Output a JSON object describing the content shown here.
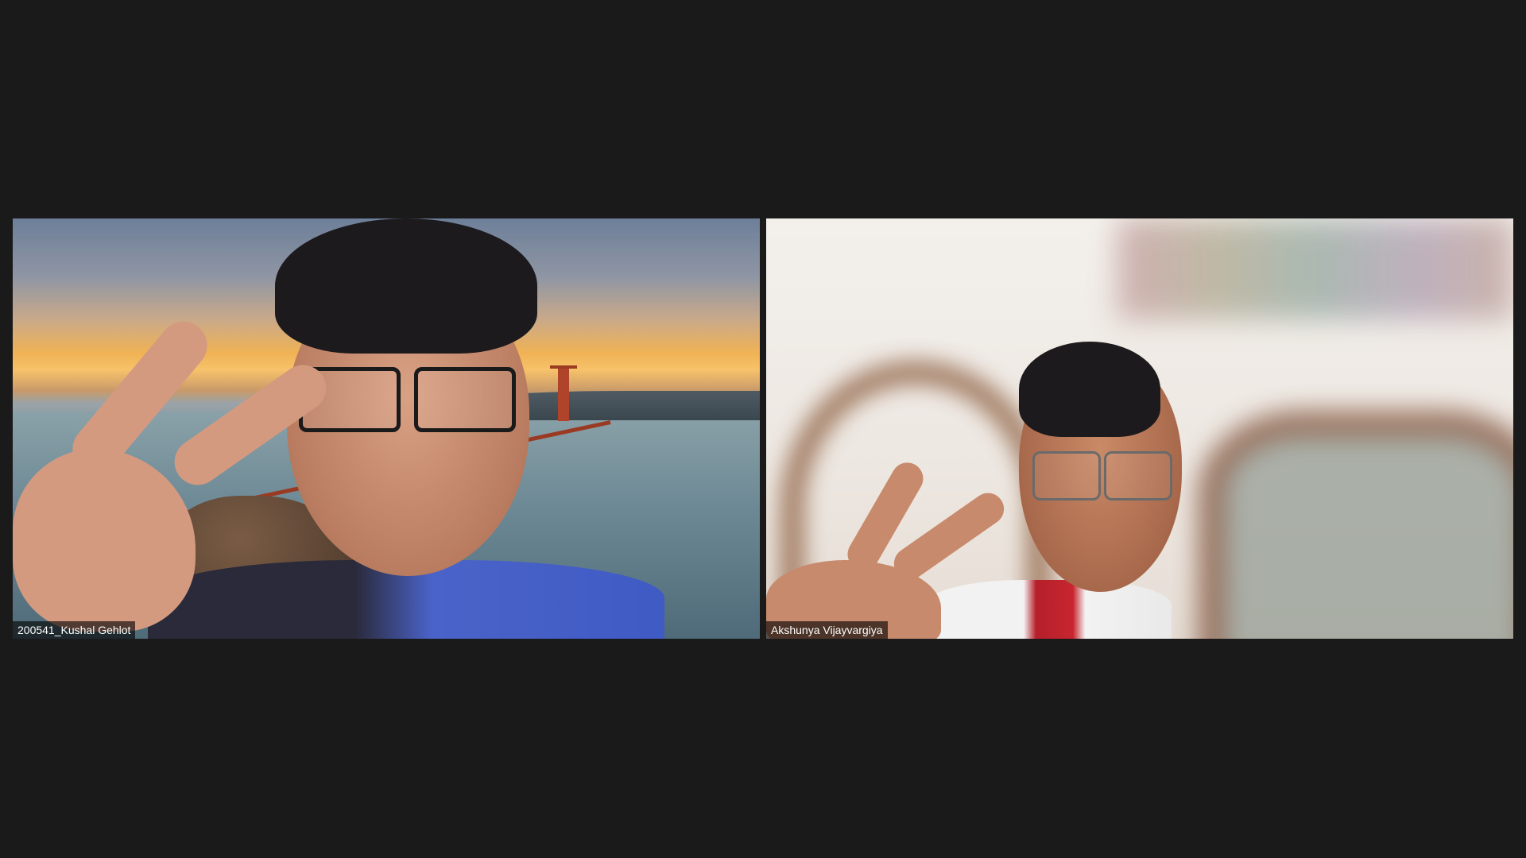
{
  "window": {
    "background_color": "#1a1a1a"
  },
  "participants": [
    {
      "name": "200541_Kushal Gehlot",
      "background": "golden-gate-sunset"
    },
    {
      "name": "Akshunya Vijayvargiya",
      "background": "blurred-room"
    }
  ]
}
